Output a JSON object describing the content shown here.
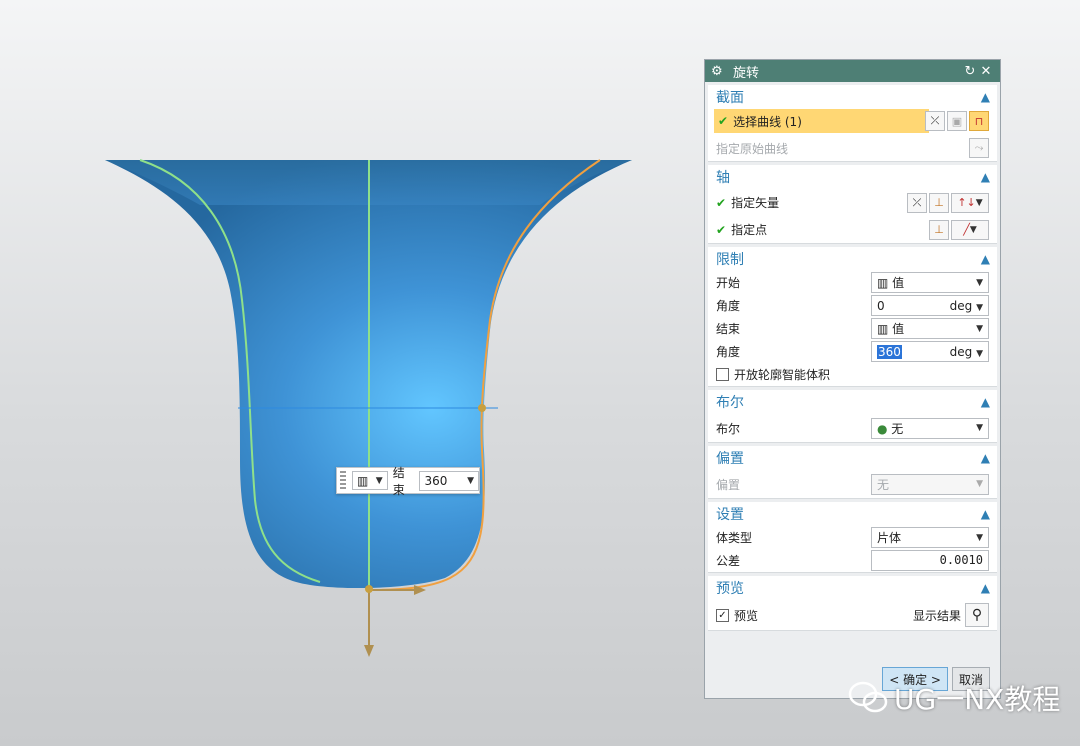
{
  "viewport": {
    "mini_toolbar": {
      "end_label": "结束",
      "end_value": "360"
    }
  },
  "dialog": {
    "title": "旋转",
    "section_profile": {
      "title": "截面",
      "select_curve": "选择曲线 (1)",
      "specify_origin_curve": "指定原始曲线"
    },
    "section_axis": {
      "title": "轴",
      "specify_vector": "指定矢量",
      "specify_point": "指定点"
    },
    "section_limits": {
      "title": "限制",
      "start_label": "开始",
      "start_value": "值",
      "start_angle_label": "角度",
      "start_angle": "0",
      "start_unit": "deg",
      "end_label": "结束",
      "end_value": "值",
      "end_angle_label": "角度",
      "end_angle": "360",
      "end_unit": "deg",
      "open_profile_label": "开放轮廓智能体积"
    },
    "section_boolean": {
      "title": "布尔",
      "boolean_label": "布尔",
      "boolean_value": "无"
    },
    "section_offset": {
      "title": "偏置",
      "offset_label": "偏置",
      "offset_value": "无"
    },
    "section_settings": {
      "title": "设置",
      "body_type_label": "体类型",
      "body_type_value": "片体",
      "tolerance_label": "公差",
      "tolerance_value": "0.0010"
    },
    "section_preview": {
      "title": "预览",
      "preview_label": "预览",
      "show_result_label": "显示结果"
    },
    "ok_label": "< 确定 >",
    "cancel_label": "取消"
  },
  "watermark": {
    "text": "UG一NX教程"
  },
  "colors": {
    "title_bar": "#4e7f75",
    "section_title": "#2f7fb4",
    "selection_highlight": "#ffd774",
    "body_blue": "#3f8fd4"
  }
}
